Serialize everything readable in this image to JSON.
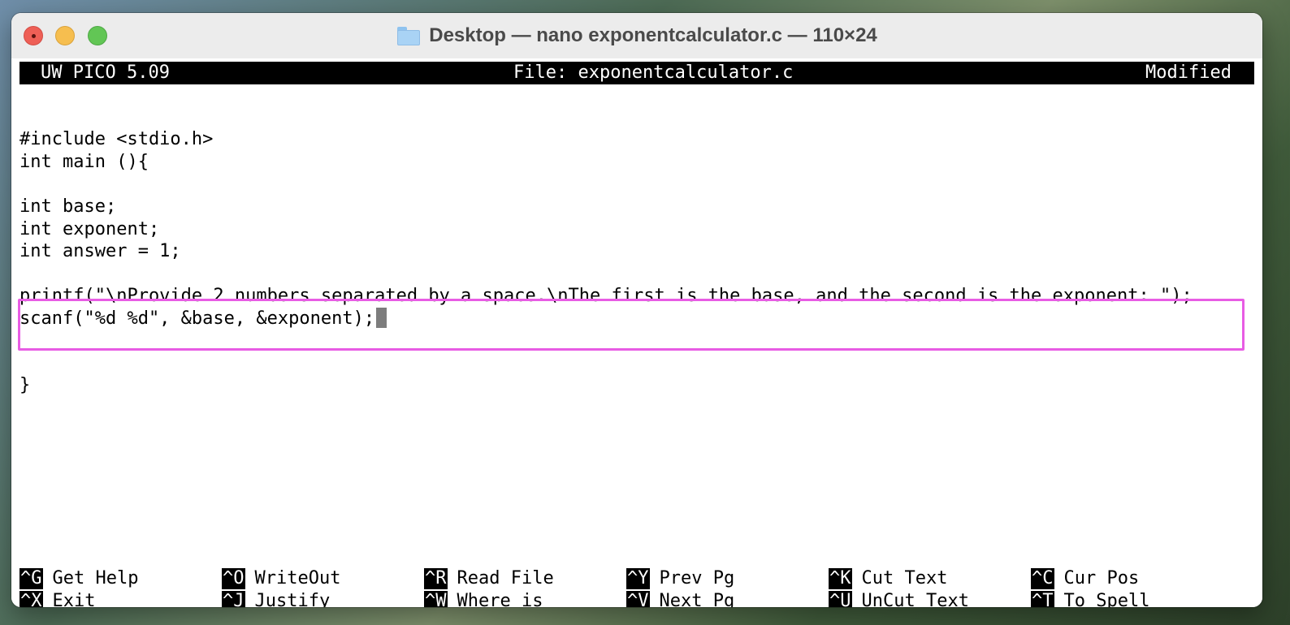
{
  "window": {
    "title": "Desktop — nano exponentcalculator.c — 110×24"
  },
  "editor": {
    "version": "UW PICO 5.09",
    "file_label": "File: exponentcalculator.c",
    "status": "Modified",
    "lines": [
      "#include <stdio.h>",
      "int main (){",
      "",
      "int base;",
      "int exponent;",
      "int answer = 1;",
      "",
      "printf(\"\\nProvide 2 numbers separated by a space.\\nThe first is the base, and the second is the exponent: \");",
      "scanf(\"%d %d\", &base, &exponent);",
      "",
      "",
      "}"
    ]
  },
  "shortcuts": [
    {
      "key": "^G",
      "label": "Get Help"
    },
    {
      "key": "^O",
      "label": "WriteOut"
    },
    {
      "key": "^R",
      "label": "Read File"
    },
    {
      "key": "^Y",
      "label": "Prev Pg"
    },
    {
      "key": "^K",
      "label": "Cut Text"
    },
    {
      "key": "^C",
      "label": "Cur Pos"
    },
    {
      "key": "^X",
      "label": "Exit"
    },
    {
      "key": "^J",
      "label": "Justify"
    },
    {
      "key": "^W",
      "label": "Where is"
    },
    {
      "key": "^V",
      "label": "Next Pg"
    },
    {
      "key": "^U",
      "label": "UnCut Text"
    },
    {
      "key": "^T",
      "label": "To Spell"
    }
  ],
  "colors": {
    "highlight_border": "#e85ce4",
    "cursor": "#7d7d7d"
  }
}
